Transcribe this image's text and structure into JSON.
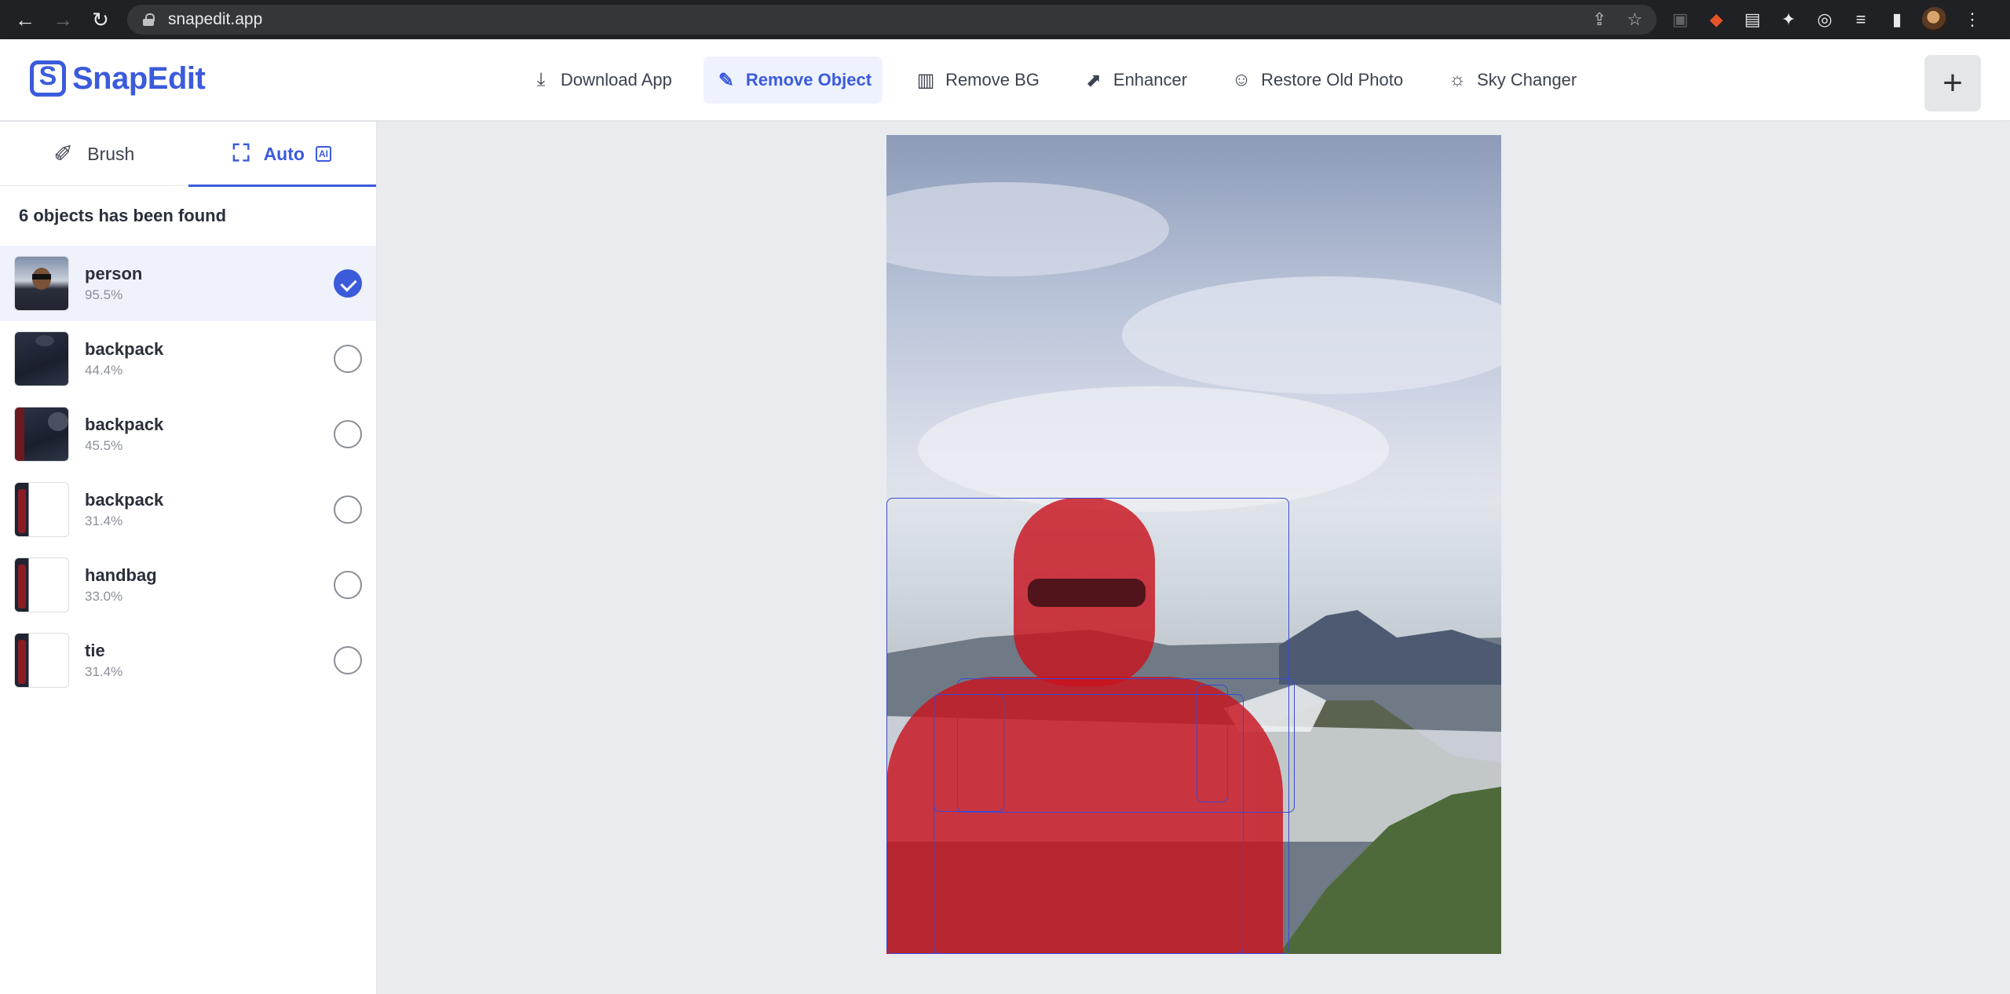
{
  "browser": {
    "url": "snapedit.app",
    "back_icon": "←",
    "forward_icon": "→",
    "reload_icon": "↻",
    "share_icon": "⇪",
    "star_icon": "☆",
    "extensions": [
      "▣",
      "◆",
      "▤",
      "✦",
      "◎",
      "≡",
      "▮",
      "⋮"
    ]
  },
  "app": {
    "logo_text": "SnapEdit",
    "nav": [
      {
        "label": "Download App",
        "icon": "⤓"
      },
      {
        "label": "Remove Object",
        "icon": "✎"
      },
      {
        "label": "Remove BG",
        "icon": "▥"
      },
      {
        "label": "Enhancer",
        "icon": "⬈"
      },
      {
        "label": "Restore Old Photo",
        "icon": "☺"
      },
      {
        "label": "Sky Changer",
        "icon": "☼"
      }
    ],
    "active_nav": "Remove Object",
    "add_button": "+"
  },
  "sidebar": {
    "tabs": [
      {
        "label": "Brush",
        "icon": "✐"
      },
      {
        "label": "Auto",
        "icon": "⛶",
        "badge": "AI"
      }
    ],
    "active_tab": "Auto",
    "found_text": "6 objects has been found",
    "objects": [
      {
        "name": "person",
        "score": "95.5%",
        "selected": true
      },
      {
        "name": "backpack",
        "score": "44.4%",
        "selected": false
      },
      {
        "name": "backpack",
        "score": "45.5%",
        "selected": false
      },
      {
        "name": "backpack",
        "score": "31.4%",
        "selected": false
      },
      {
        "name": "handbag",
        "score": "33.0%",
        "selected": false
      },
      {
        "name": "tie",
        "score": "31.4%",
        "selected": false
      }
    ]
  },
  "colors": {
    "accent": "#3b5bdb",
    "mask": "#c8141e",
    "box": "#3b49d6"
  }
}
